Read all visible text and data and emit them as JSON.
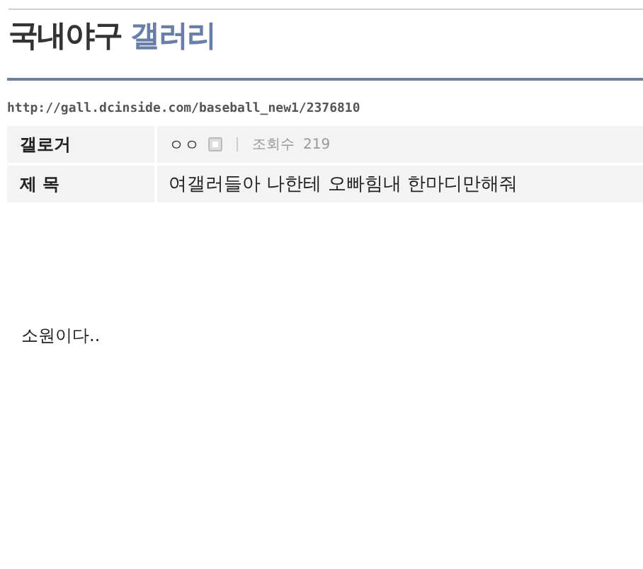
{
  "gallery": {
    "name": "국내야구",
    "suffix": "갤러리"
  },
  "url": "http://gall.dcinside.com/baseball_new1/2376810",
  "info": {
    "author_label": "갤로거",
    "author": "ㅇㅇ",
    "views_label": "조회수",
    "views": "219",
    "subject_label": "제 목",
    "subject": "여갤러들아 나한테 오빠힘내 한마디만해줘"
  },
  "body": "소원이다.."
}
